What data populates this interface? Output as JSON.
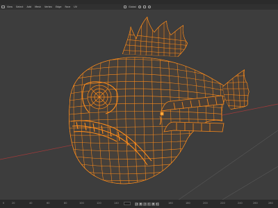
{
  "header": {
    "mode_icon": "object-mode-icon",
    "menu_items": [
      "View",
      "Select",
      "Add",
      "Mesh",
      "Vertex",
      "Edge",
      "Face",
      "UV"
    ],
    "transform_orientation": "Global",
    "pivot_icon": "pivot-icon",
    "snap_icon": "snap-icon"
  },
  "viewport": {
    "object": "fish-mesh",
    "wire_color": "#ff8c1a",
    "background": "#3d3d3d",
    "x_axis_color": "#b33a3a",
    "y_axis_color": "#8aa83a"
  },
  "timeline": {
    "ticks": [
      "0",
      "20",
      "40",
      "60",
      "80",
      "100",
      "120",
      "140",
      "160",
      "180",
      "200",
      "220",
      "240",
      "260",
      "280"
    ],
    "playback_icons": [
      "jump-start-icon",
      "prev-keyframe-icon",
      "play-reverse-icon",
      "play-icon",
      "next-keyframe-icon",
      "jump-end-icon"
    ]
  }
}
